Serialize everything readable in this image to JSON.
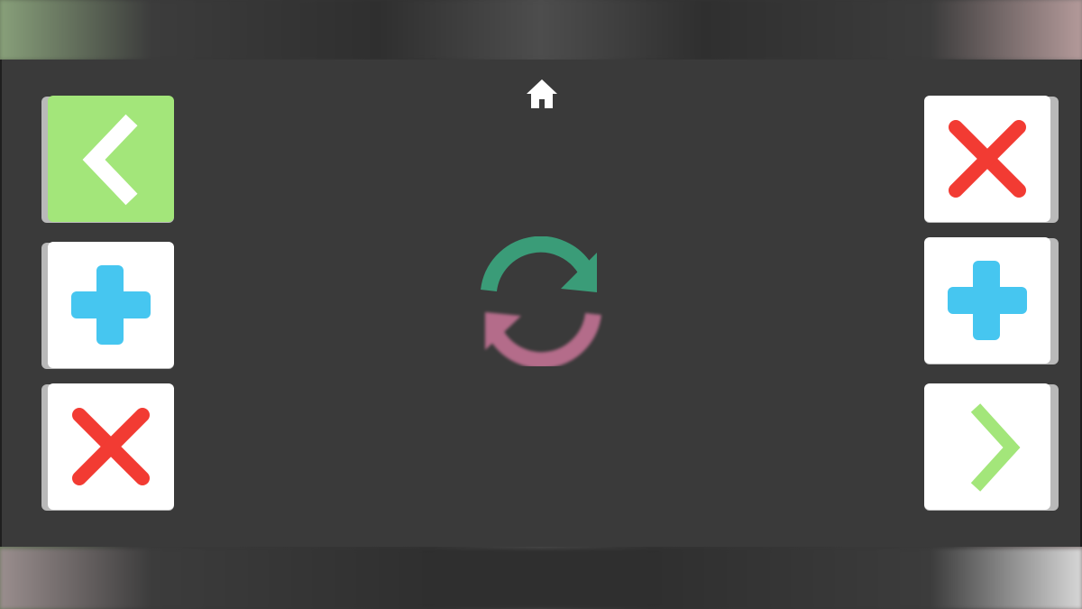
{
  "screen": {
    "home_icon": "home-icon",
    "center_icon": "refresh-icon",
    "colors": {
      "background": "#3a3a3a",
      "tile": "#ffffff",
      "tile_selected": "#a3e67a",
      "red": "#f23b33",
      "blue": "#46c6f0",
      "green": "#a3e67a",
      "refresh_top": "#3a9c78",
      "refresh_bottom": "#b46c8a"
    }
  },
  "left_tiles": [
    {
      "icon": "chevron-left-icon",
      "selected": true
    },
    {
      "icon": "plus-icon",
      "selected": false
    },
    {
      "icon": "close-icon",
      "selected": false
    }
  ],
  "right_tiles": [
    {
      "icon": "close-icon",
      "selected": false
    },
    {
      "icon": "plus-icon",
      "selected": false
    },
    {
      "icon": "chevron-right-icon",
      "selected": false
    }
  ]
}
